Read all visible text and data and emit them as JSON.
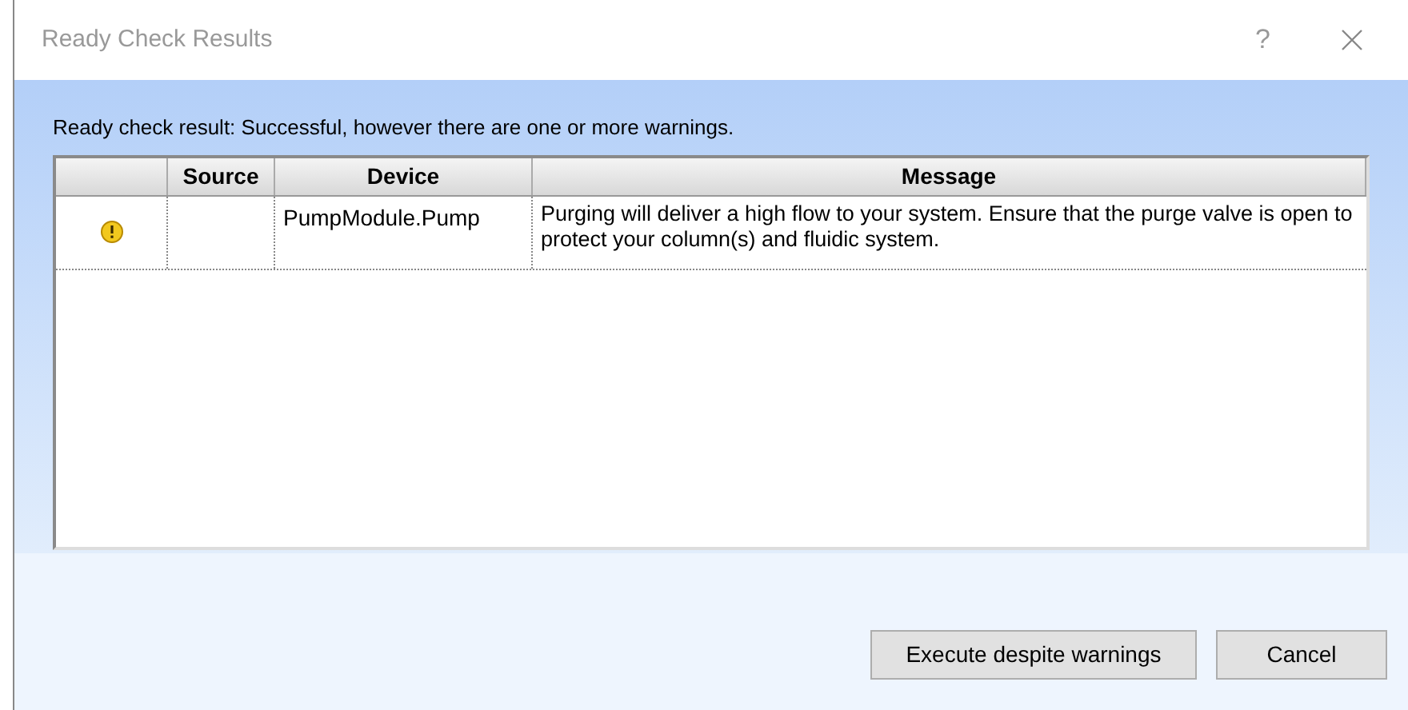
{
  "window": {
    "title": "Ready Check Results",
    "help": "?"
  },
  "summary": "Ready check result: Successful, however there are one or more warnings.",
  "table": {
    "columns": [
      "",
      "Source",
      "Device",
      "Message"
    ],
    "rows": [
      {
        "kind": "warning",
        "source": "",
        "device": "PumpModule.Pump",
        "message": "Purging will deliver a high flow to your system. Ensure that the purge valve is open to protect your column(s) and fluidic system."
      }
    ]
  },
  "buttons": [
    "Execute despite warnings",
    "Cancel"
  ]
}
